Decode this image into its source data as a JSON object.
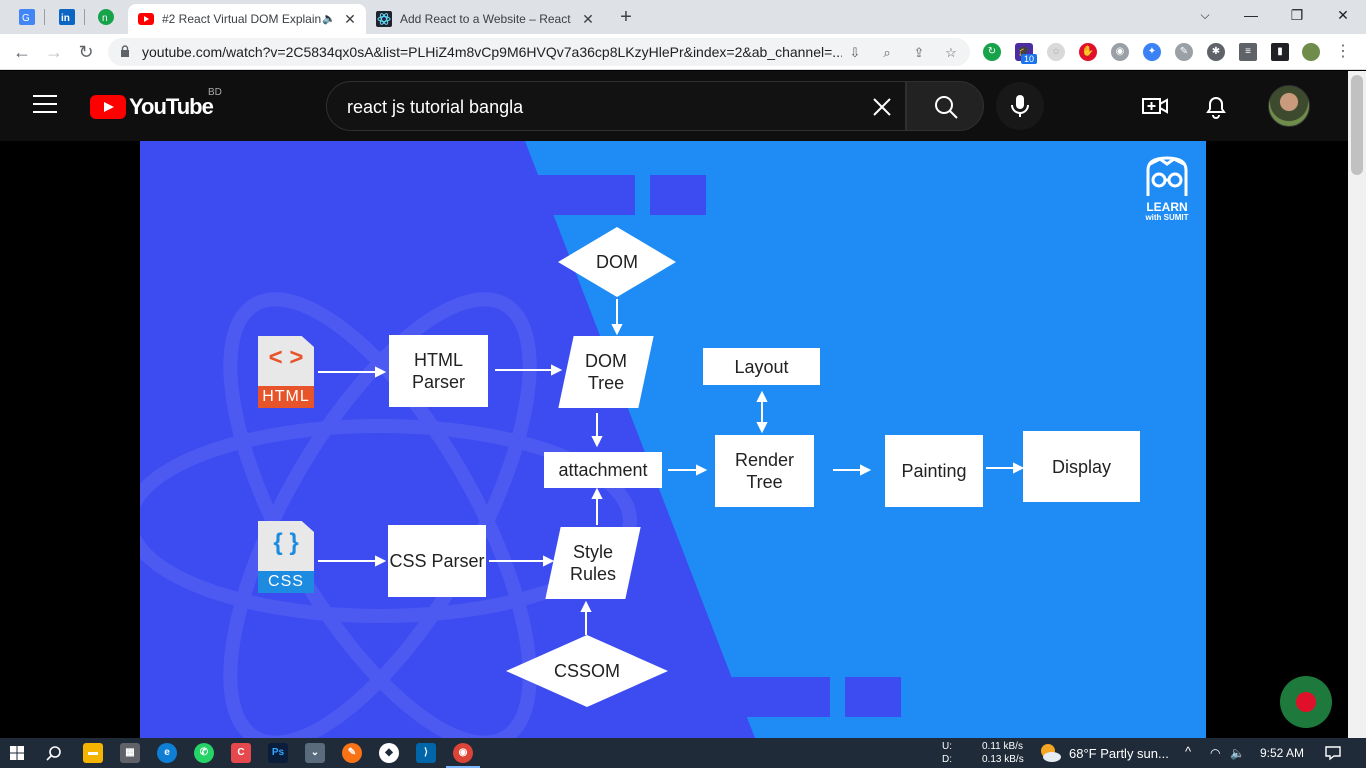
{
  "browser": {
    "tabs": [
      {
        "title": "#2 React Virtual DOM Explain",
        "active": true
      },
      {
        "title": "Add React to a Website – React",
        "active": false
      }
    ],
    "new_tab": "+",
    "url": "youtube.com/watch?v=2C5834qx0sA&list=PLHiZ4m8vCp9M6HVQv7a36cp8LKzyHlePr&index=2&ab_channel=...",
    "extension_badge": "10",
    "window_controls": {
      "minimize": "—",
      "restore": "❐",
      "close": "✕"
    }
  },
  "youtube": {
    "logo_text": "YouTube",
    "country_code": "BD",
    "search_query": "react js tutorial bangla"
  },
  "diagram": {
    "logo_line1": "LEARN",
    "logo_line2": "with SUMIT",
    "html_file_label": "HTML",
    "html_glyph": "< >",
    "css_file_label": "CSS",
    "css_glyph": "{ }",
    "dom": "DOM",
    "html_parser": "HTML Parser",
    "dom_tree": "DOM Tree",
    "layout": "Layout",
    "attachment": "attachment",
    "render_tree": "Render Tree",
    "painting": "Painting",
    "display": "Display",
    "css_parser": "CSS Parser",
    "style_rules": "Style Rules",
    "cssom": "CSSOM"
  },
  "taskbar": {
    "net_up_label": "U:",
    "net_down_label": "D:",
    "net_up": "0.11 kB/s",
    "net_down": "0.13 kB/s",
    "weather": "68°F  Partly sun...",
    "time": "9:52 AM"
  },
  "colors": {
    "slide_light": "#1e8cf4",
    "slide_dark": "#3d4cf0",
    "html_orange": "#e8542a",
    "css_blue": "#1d8be0",
    "youtube_red": "#ff0000"
  }
}
